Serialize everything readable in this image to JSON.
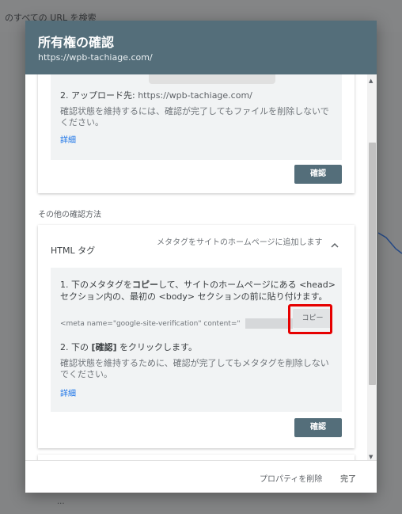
{
  "background": {
    "search_text": "のすべての URL を検索",
    "footer_fragment": "..."
  },
  "dialog": {
    "title": "所有権の確認",
    "url": "https://wpb-tachiage.com/",
    "card1": {
      "step2_prefix": "2. アップロード先: ",
      "step2_url": "https://wpb-tachiage.com/",
      "keep_note": "確認状態を維持するには、確認が完了してもファイルを削除しないでください。",
      "detail_link": "詳細",
      "confirm_label": "確認"
    },
    "other_methods_label": "その他の確認方法",
    "html_tag": {
      "title": "HTML タグ",
      "description": "メタタグをサイトのホームページに追加します",
      "chevron": "^",
      "instruction1_prefix": "1. 下のメタタグを",
      "instruction1_bold": "コピー",
      "instruction1_suffix": "して、サイトのホームページにある <head> セクション内の、最初の <body> セクションの前に貼り付けます。",
      "meta_text": "<meta name=\"google-site-verification\" content=\"",
      "copy_label": "コピー",
      "instruction2_prefix": "2. 下の ",
      "instruction2_bold": "[確認]",
      "instruction2_suffix": " をクリックします。",
      "keep_note": "確認状態を維持するために、確認が完了してもメタタグを削除しないでください。",
      "detail_link": "詳細",
      "confirm_label": "確認"
    },
    "footer": {
      "delete_label": "プロパティを削除",
      "done_label": "完了"
    }
  },
  "colors": {
    "header": "#546e7a",
    "link": "#1a73e8",
    "highlight": "#e60000"
  }
}
